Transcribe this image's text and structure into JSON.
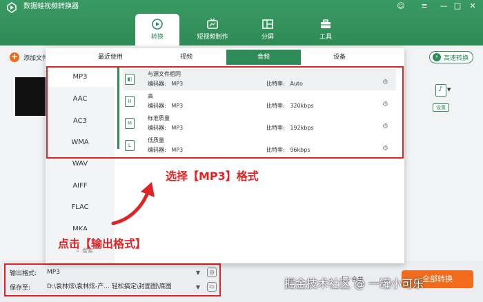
{
  "app": {
    "title": "数据蛙视频转换器",
    "window_controls": [
      "☺",
      "≡",
      "—",
      "□",
      "✕"
    ]
  },
  "nav": {
    "tabs": [
      {
        "label": "转换",
        "icon": "convert-icon",
        "active": true
      },
      {
        "label": "短视频制作",
        "icon": "tv-icon",
        "active": false
      },
      {
        "label": "分屏",
        "icon": "split-screen-icon",
        "active": false
      },
      {
        "label": "工具",
        "icon": "toolbox-icon",
        "active": false
      }
    ]
  },
  "toolbar": {
    "add_file": "添加文件",
    "fast_convert": "高速转换"
  },
  "right_panel": {
    "settings": "设置"
  },
  "popup": {
    "tabs": [
      {
        "label": "最近使用",
        "active": false
      },
      {
        "label": "视频",
        "active": false
      },
      {
        "label": "音频",
        "active": true
      },
      {
        "label": "设备",
        "active": false
      }
    ],
    "formats": [
      "MP3",
      "AAC",
      "AC3",
      "WMA",
      "WAV",
      "AIFF",
      "FLAC",
      "MKA"
    ],
    "selected_format": "MP3",
    "search_label": "搜索",
    "qualities": [
      {
        "name": "与源文件相同",
        "encoder_label": "编码器:",
        "encoder": "MP3",
        "bitrate_label": "比特率:",
        "bitrate": "Auto",
        "icon_text": "◧"
      },
      {
        "name": "高",
        "encoder_label": "编码器:",
        "encoder": "MP3",
        "bitrate_label": "比特率:",
        "bitrate": "320kbps",
        "icon_text": "H"
      },
      {
        "name": "标准质量",
        "encoder_label": "编码器:",
        "encoder": "MP3",
        "bitrate_label": "比特率:",
        "bitrate": "192kbps",
        "icon_text": "M"
      },
      {
        "name": "低质量",
        "encoder_label": "编码器:",
        "encoder": "MP3",
        "bitrate_label": "比特率:",
        "bitrate": "96kbps",
        "icon_text": "L"
      }
    ]
  },
  "bottom": {
    "output_format_label": "输出格式:",
    "output_format_value": "MP3",
    "save_to_label": "保存至:",
    "save_to_value": "D:\\袁林炫\\袁林炫-产...    轻松搞定\\封面图\\底图",
    "merge_label": "合并",
    "convert_button": "全部转换"
  },
  "annotations": {
    "select_mp3": "选择【MP3】格式",
    "click_output": "点击【输出格式】",
    "accent_color": "#e02424"
  },
  "watermark": "掘金技术社区 @ 一罐小可乐",
  "colors": {
    "brand_green": "#2e8b57",
    "accent_orange": "#f26a1b"
  }
}
